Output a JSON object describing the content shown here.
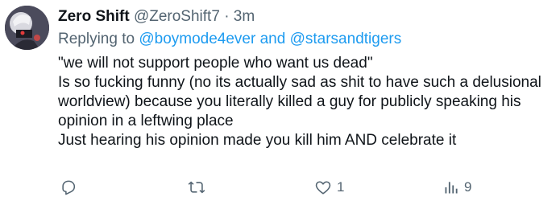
{
  "tweet": {
    "display_name": "Zero Shift",
    "handle": "@ZeroShift7",
    "separator": "·",
    "timestamp": "3m",
    "replying_to_label": "Replying to",
    "replying_to": [
      "@boymode4ever",
      "@starsandtigers"
    ],
    "replying_to_joiner": "and",
    "text_lines": [
      "\"we will not support people who want us dead\"",
      "Is so fucking funny (no its actually sad as shit to have such a delusional",
      "worldview) because you literally killed a guy for publicly speaking his",
      "opinion in a leftwing place",
      "Just hearing his opinion made you kill him AND celebrate it"
    ]
  },
  "actions": {
    "reply_icon": "reply-icon",
    "retweet_icon": "retweet-icon",
    "like_icon": "heart-icon",
    "like_count": "1",
    "views_icon": "views-chart-icon",
    "views_count": "9"
  },
  "colors": {
    "text": "#0f1419",
    "secondary": "#536471",
    "link": "#1d9bf0",
    "background": "#ffffff"
  }
}
